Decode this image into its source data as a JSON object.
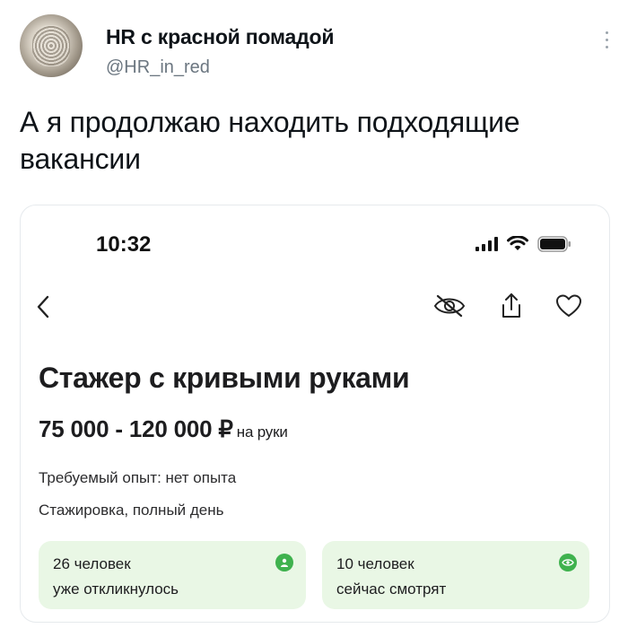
{
  "tweet": {
    "display_name": "HR с красной помадой",
    "handle": "@HR_in_red",
    "text": "А я продолжаю находить подходящие вакансии"
  },
  "phone": {
    "time": "10:32"
  },
  "vacancy": {
    "title": "Стажер с кривыми руками",
    "salary": "75 000 - 120 000 ₽",
    "salary_note": "на руки",
    "experience": "Требуемый опыт: нет опыта",
    "schedule": "Стажировка, полный день"
  },
  "stats": [
    {
      "line1": "26 человек",
      "line2": "уже откликнулось",
      "icon": "person-icon"
    },
    {
      "line1": "10 человек",
      "line2": "сейчас смотрят",
      "icon": "eye-icon"
    }
  ],
  "colors": {
    "stat_bg": "#e9f7e5",
    "stat_icon": "#3fb24e"
  }
}
